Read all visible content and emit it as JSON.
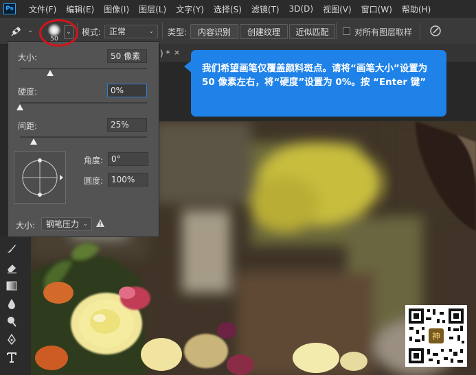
{
  "menubar": {
    "logo": "Ps",
    "items": [
      "文件(F)",
      "编辑(E)",
      "图像(I)",
      "图层(L)",
      "文字(Y)",
      "选择(S)",
      "滤镜(T)",
      "3D(D)",
      "视图(V)",
      "窗口(W)",
      "帮助(H)"
    ]
  },
  "options_bar": {
    "brush_size_badge": "50",
    "mode_label": "模式:",
    "mode_value": "正常",
    "type_label": "类型:",
    "type_buttons": [
      "内容识别",
      "创建纹理",
      "近似匹配"
    ],
    "sample_all_label": "对所有图层取样"
  },
  "document_tab": {
    "title": ") *",
    "close": "×"
  },
  "brush_panel": {
    "size_label": "大小:",
    "size_value": "50 像素",
    "size_fraction": 0.24,
    "hardness_label": "硬度:",
    "hardness_value": "0%",
    "hardness_fraction": 0.0,
    "spacing_label": "间距:",
    "spacing_value": "25%",
    "spacing_fraction": 0.11,
    "angle_label": "角度:",
    "angle_value": "0°",
    "roundness_label": "圆度:",
    "roundness_value": "100%",
    "pen_size_label": "大小:",
    "pen_pressure_value": "钢笔压力"
  },
  "callout": {
    "text": "我们希望画笔仅覆盖颜料斑点。请将“画笔大小”设置为 50 像素左右，将“硬度”设置为 0%。按 “Enter 键”"
  },
  "qr": {
    "center_char": "神"
  },
  "colors": {
    "callout": "#1f82e8",
    "highlight_circle": "#d4141a",
    "panel": "#535353",
    "menubar": "#2b2b2b"
  }
}
